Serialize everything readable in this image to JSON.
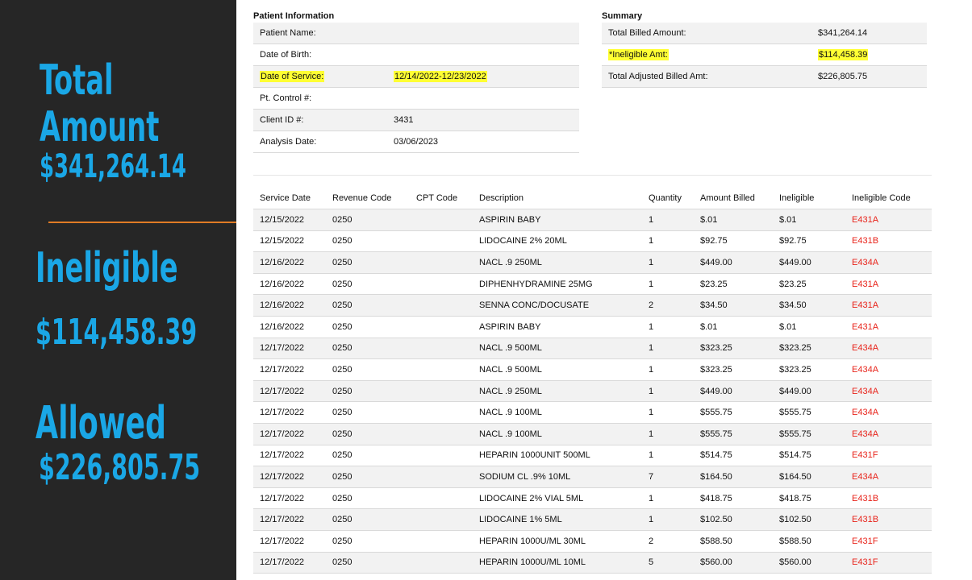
{
  "left_panel": {
    "total_label_line1": "Total",
    "total_label_line2": "Amount",
    "total_value": "$341,264.14",
    "ineligible_label": "Ineligible",
    "ineligible_value": "$114,458.39",
    "allowed_label": "Allowed",
    "allowed_value": "$226,805.75",
    "accent_color": "#1aa7e6",
    "divider_color": "#e07b25"
  },
  "patient_info": {
    "title": "Patient Information",
    "rows": [
      {
        "label": "Patient Name:",
        "value": ""
      },
      {
        "label": "Date of Birth:",
        "value": ""
      },
      {
        "label": "Date of Service:",
        "value": "12/14/2022-12/23/2022"
      },
      {
        "label": "Pt. Control #:",
        "value": ""
      },
      {
        "label": "Client ID #:",
        "value": "3431"
      },
      {
        "label": "Analysis Date:",
        "value": "03/06/2023"
      }
    ]
  },
  "summary": {
    "title": "Summary",
    "rows": [
      {
        "label": "Total Billed Amount:",
        "value": "$341,264.14"
      },
      {
        "label": "*Ineligible Amt:",
        "value": "$114,458.39"
      },
      {
        "label": "Total Adjusted Billed Amt:",
        "value": "$226,805.75"
      }
    ]
  },
  "services": {
    "headers": [
      "Service Date",
      "Revenue Code",
      "CPT Code",
      "Description",
      "Quantity",
      "Amount Billed",
      "Ineligible",
      "Ineligible Code"
    ],
    "rows": [
      [
        "12/15/2022",
        "0250",
        "",
        "ASPIRIN BABY",
        "1",
        "$.01",
        "$.01",
        "E431A"
      ],
      [
        "12/15/2022",
        "0250",
        "",
        "LIDOCAINE 2% 20ML",
        "1",
        "$92.75",
        "$92.75",
        "E431B"
      ],
      [
        "12/16/2022",
        "0250",
        "",
        "NACL .9 250ML",
        "1",
        "$449.00",
        "$449.00",
        "E434A"
      ],
      [
        "12/16/2022",
        "0250",
        "",
        "DIPHENHYDRAMINE 25MG",
        "1",
        "$23.25",
        "$23.25",
        "E431A"
      ],
      [
        "12/16/2022",
        "0250",
        "",
        "SENNA CONC/DOCUSATE",
        "2",
        "$34.50",
        "$34.50",
        "E431A"
      ],
      [
        "12/16/2022",
        "0250",
        "",
        "ASPIRIN BABY",
        "1",
        "$.01",
        "$.01",
        "E431A"
      ],
      [
        "12/17/2022",
        "0250",
        "",
        "NACL .9 500ML",
        "1",
        "$323.25",
        "$323.25",
        "E434A"
      ],
      [
        "12/17/2022",
        "0250",
        "",
        "NACL .9 500ML",
        "1",
        "$323.25",
        "$323.25",
        "E434A"
      ],
      [
        "12/17/2022",
        "0250",
        "",
        "NACL .9 250ML",
        "1",
        "$449.00",
        "$449.00",
        "E434A"
      ],
      [
        "12/17/2022",
        "0250",
        "",
        "NACL .9 100ML",
        "1",
        "$555.75",
        "$555.75",
        "E434A"
      ],
      [
        "12/17/2022",
        "0250",
        "",
        "NACL .9 100ML",
        "1",
        "$555.75",
        "$555.75",
        "E434A"
      ],
      [
        "12/17/2022",
        "0250",
        "",
        "HEPARIN 1000UNIT 500ML",
        "1",
        "$514.75",
        "$514.75",
        "E431F"
      ],
      [
        "12/17/2022",
        "0250",
        "",
        "SODIUM CL .9% 10ML",
        "7",
        "$164.50",
        "$164.50",
        "E434A"
      ],
      [
        "12/17/2022",
        "0250",
        "",
        "LIDOCAINE 2% VIAL 5ML",
        "1",
        "$418.75",
        "$418.75",
        "E431B"
      ],
      [
        "12/17/2022",
        "0250",
        "",
        "LIDOCAINE 1% 5ML",
        "1",
        "$102.50",
        "$102.50",
        "E431B"
      ],
      [
        "12/17/2022",
        "0250",
        "",
        "HEPARIN 1000U/ML 30ML",
        "2",
        "$588.50",
        "$588.50",
        "E431F"
      ],
      [
        "12/17/2022",
        "0250",
        "",
        "HEPARIN 1000U/ML 10ML",
        "5",
        "$560.00",
        "$560.00",
        "E431F"
      ]
    ],
    "code_color": "#e8231a"
  }
}
